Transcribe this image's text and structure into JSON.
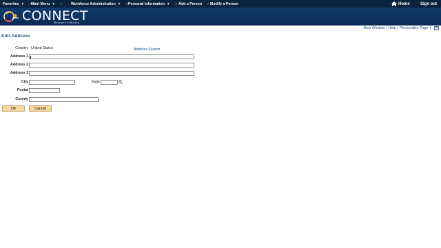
{
  "nav": {
    "items": [
      {
        "label": "Favorites",
        "has_menu": true
      },
      {
        "label": "Main Menu",
        "has_menu": true
      },
      {
        "label": "Workforce Administration",
        "has_menu": true
      },
      {
        "label": "Personal Information",
        "has_menu": true
      },
      {
        "label": "Add a Person",
        "has_menu": false
      },
      {
        "label": "Modify a Person",
        "has_menu": false
      }
    ],
    "home_label": "Home",
    "signout_label": "Sign out"
  },
  "banner": {
    "logo_text": "CONNECT",
    "logo_subtitle": "Maryland Judiciary"
  },
  "utility": {
    "new_window": "New Window",
    "help": "Help",
    "personalize": "Personalize Page",
    "separator": "|"
  },
  "page": {
    "title": "Edit Address"
  },
  "form": {
    "country_label": "Country",
    "country_value": "United States",
    "address_search": "Address Search",
    "address1_label": "Address 1",
    "address1_value": "",
    "address2_label": "Address 2",
    "address2_value": "",
    "address3_label": "Address 3",
    "address3_value": "",
    "city_label": "City",
    "city_value": "",
    "state_label": "State",
    "state_value": "",
    "postal_label": "Postal",
    "postal_value": "",
    "county_label": "County",
    "county_value": ""
  },
  "buttons": {
    "ok": "OK",
    "cancel": "Cancel"
  },
  "colors": {
    "nav_bg": "#0b2240",
    "banner_bg": "#0f3a6c",
    "link": "#0b4e8f",
    "title": "#2a5e9c",
    "button_bg": "#f8d9a4"
  }
}
